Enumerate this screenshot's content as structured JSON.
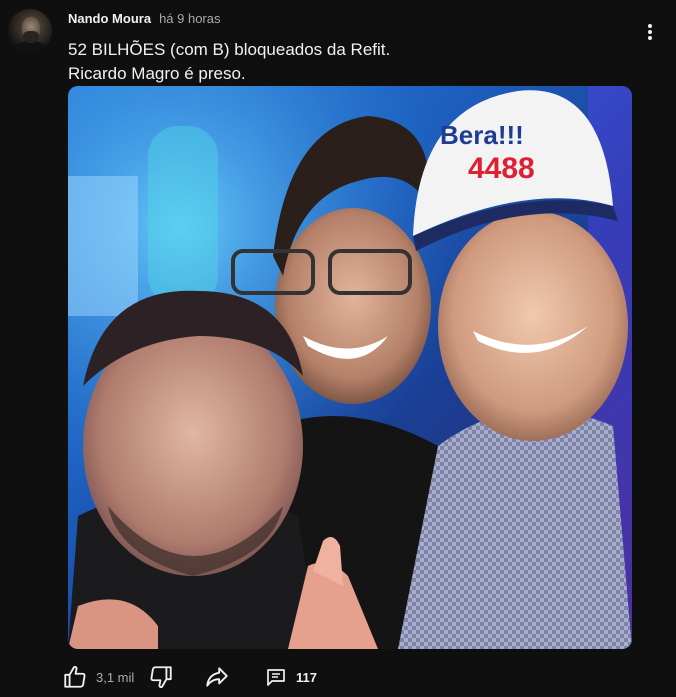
{
  "post": {
    "author": "Nando Moura",
    "time": "há 9 horas",
    "text_lines": [
      "52 BILHÕES (com B) bloqueados da Refit.",
      "Ricardo Magro é preso."
    ],
    "image": {
      "cap_text_top": "Bera!!!",
      "cap_text_number": "4488"
    }
  },
  "actions": {
    "like_count": "3,1 mil",
    "comment_count": "117"
  },
  "icons": {
    "more": "more-vert-icon",
    "like": "thumbs-up-icon",
    "dislike": "thumbs-down-icon",
    "share": "share-icon",
    "comment": "comment-icon"
  },
  "colors": {
    "background": "#0f0f0f",
    "text_primary": "#f1f1f1",
    "text_secondary": "#aaaaaa"
  }
}
